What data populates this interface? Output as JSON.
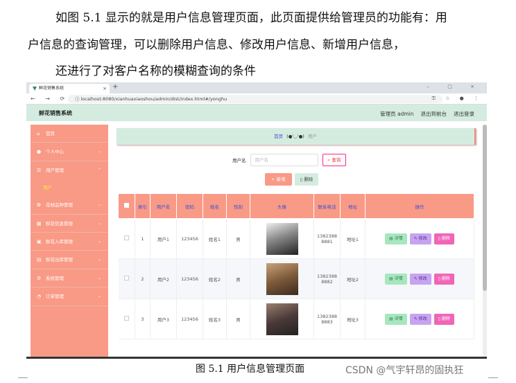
{
  "doc": {
    "para1": "如图 5.1 显示的就是用户信息管理页面，此页面提供给管理员的功能有：用",
    "para2": "户信息的查询管理，可以删除用户信息、修改用户信息、新增用户信息，",
    "para3": "还进行了对客户名称的模糊查询的条件",
    "caption": "图 5.1  用户信息管理页面",
    "watermark": "CSDN @气宇轩昂的固执狂"
  },
  "browser": {
    "tab_title": "鲜花销售系统",
    "url": "localhost:8080/xianhuaxiaoshou/admin/dist/index.html#/yonghu"
  },
  "app": {
    "brand": "鲜花销售系统",
    "admin": "管理员 admin",
    "back_front": "退出到前台",
    "logout": "退出登录"
  },
  "sidebar": {
    "items": [
      {
        "label": "首页",
        "icon": "home-icon"
      },
      {
        "label": "个人中心",
        "icon": "user-icon"
      },
      {
        "label": "用户管理",
        "icon": "list-icon"
      },
      {
        "label": "用户",
        "icon": ""
      },
      {
        "label": "花材品种管理",
        "icon": "flower-icon"
      },
      {
        "label": "鲜花信息管理",
        "icon": "grid-icon"
      },
      {
        "label": "鲜花入库管理",
        "icon": "box-icon"
      },
      {
        "label": "鲜花出库管理",
        "icon": "out-icon"
      },
      {
        "label": "系统管理",
        "icon": "gear-icon"
      },
      {
        "label": "订单管理",
        "icon": "order-icon"
      }
    ]
  },
  "breadcrumb": {
    "home": "首页",
    "emoji": "(●'◡'●)",
    "current": "用户"
  },
  "search": {
    "label": "用户名",
    "placeholder": "用户名",
    "button": "查询"
  },
  "ops": {
    "add": "新增",
    "delete": "删除"
  },
  "table": {
    "headers": [
      "索引",
      "用户名",
      "密码",
      "姓名",
      "性别",
      "头像",
      "联系电话",
      "地址",
      "操作"
    ],
    "rows": [
      {
        "index": "1",
        "username": "用户1",
        "password": "123456",
        "name": "姓名1",
        "gender": "男",
        "phone1": "1382388",
        "phone2": "8881",
        "address": "地址1"
      },
      {
        "index": "2",
        "username": "用户2",
        "password": "123456",
        "name": "姓名2",
        "gender": "男",
        "phone1": "1382388",
        "phone2": "8882",
        "address": "地址2"
      },
      {
        "index": "3",
        "username": "用户3",
        "password": "123456",
        "name": "姓名3",
        "gender": "男",
        "phone1": "1382388",
        "phone2": "8883",
        "address": "地址3"
      }
    ],
    "actions": {
      "detail": "详情",
      "edit": "修改",
      "delete": "删除"
    }
  },
  "colors": {
    "sidebar": "#f99a86",
    "header": "#d4ece0",
    "accent": "#3b4fd6"
  }
}
